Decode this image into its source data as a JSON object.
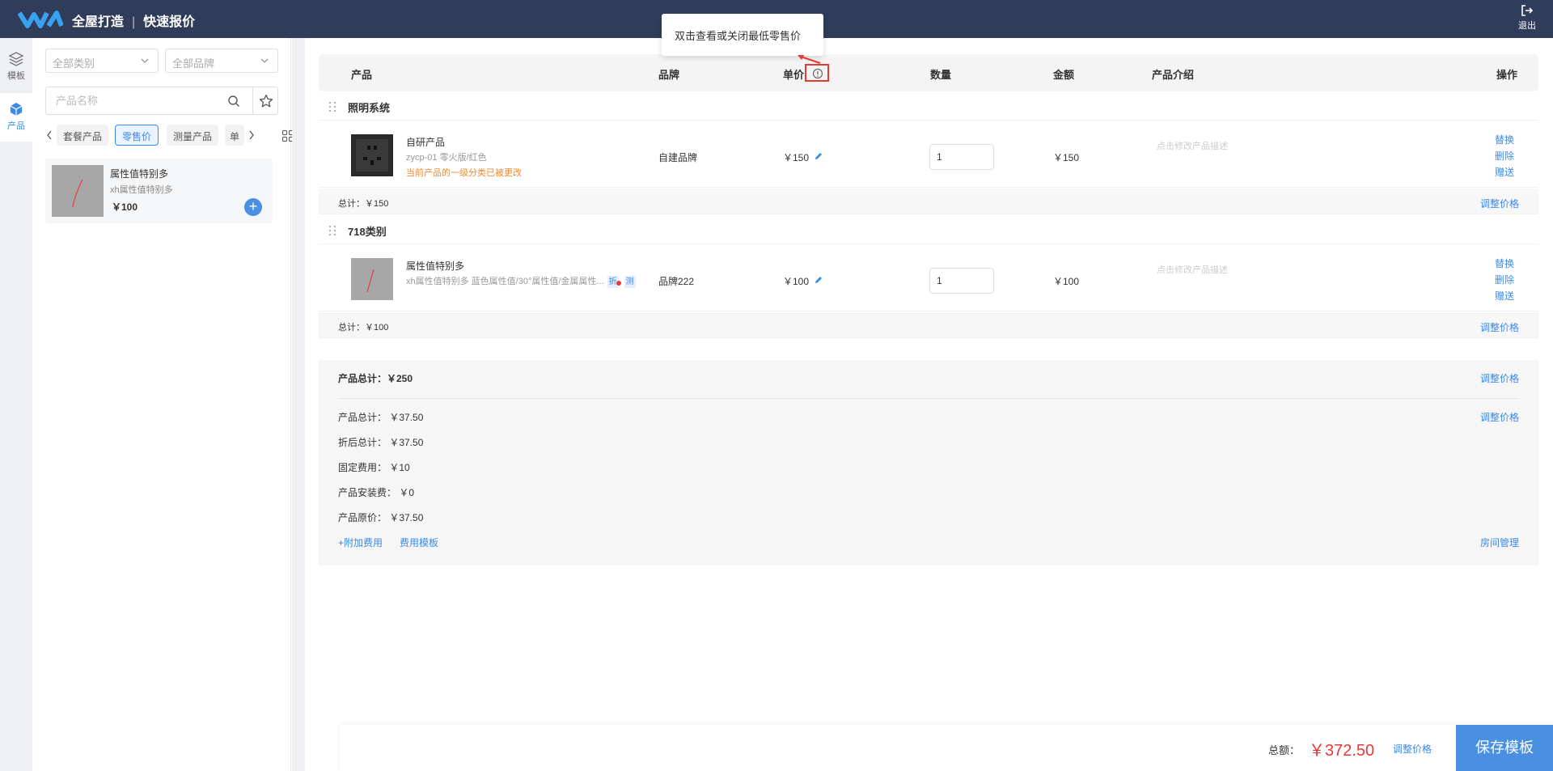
{
  "header": {
    "app_name": "全屋打造",
    "page_title": "快速报价",
    "logout_label": "退出"
  },
  "rail": [
    {
      "label": "模板",
      "icon": "layers-icon",
      "active": false
    },
    {
      "label": "产品",
      "icon": "box-icon",
      "active": true
    }
  ],
  "panel": {
    "category_select": "全部类别",
    "brand_select": "全部品牌",
    "search_placeholder": "产品名称",
    "tabs": [
      "套餐产品",
      "零售价",
      "测量产品",
      "单"
    ],
    "active_tab": "零售价",
    "product_card": {
      "name": "属性值特别多",
      "attr": "xh属性值特别多",
      "price": "￥100"
    }
  },
  "table": {
    "headers": {
      "product": "产品",
      "brand": "品牌",
      "unit_price": "单价",
      "quantity": "数量",
      "amount": "金额",
      "description": "产品介绍",
      "actions": "操作"
    },
    "tooltip": "双击查看或关闭最低零售价",
    "groups": [
      {
        "title": "照明系统",
        "rows": [
          {
            "name": "自研产品",
            "spec": "zycp-01 零火版/红色",
            "warning": "当前产品的一级分类已被更改",
            "brand": "自建品牌",
            "price": "￥150",
            "qty": "1",
            "amount": "￥150",
            "desc": "点击修改产品描述"
          }
        ],
        "subtotal": "总计：￥150"
      },
      {
        "title": "718类别",
        "rows": [
          {
            "name": "属性值特别多",
            "spec": "xh属性值特别多 蓝色属性值/30°属性值/金属属性...",
            "tags": [
              "折",
              "测"
            ],
            "brand": "品牌222",
            "price": "￥100",
            "qty": "1",
            "amount": "￥100",
            "desc": "点击修改产品描述"
          }
        ],
        "subtotal": "总计：￥100"
      }
    ],
    "ops": {
      "replace": "替换",
      "delete": "删除",
      "gift": "赠送"
    },
    "adjust_price": "调整价格"
  },
  "summary": {
    "product_total": "产品总计：￥250",
    "items": [
      "产品总计：  ￥37.50",
      "折后总计：  ￥37.50",
      "固定费用：  ￥10",
      "产品安装费：  ￥0",
      "产品原价：  ￥37.50"
    ],
    "add_fee": "+附加费用",
    "fee_template": "费用模板",
    "room_manage": "房间管理"
  },
  "footer": {
    "total_label": "总额：",
    "total_value": "￥372.50",
    "adjust_price": "调整价格",
    "save_button": "保存模板"
  },
  "colors": {
    "topbar": "#303d5a",
    "accent": "#3b8aea",
    "danger": "#e53935",
    "warning": "#f5892a"
  }
}
